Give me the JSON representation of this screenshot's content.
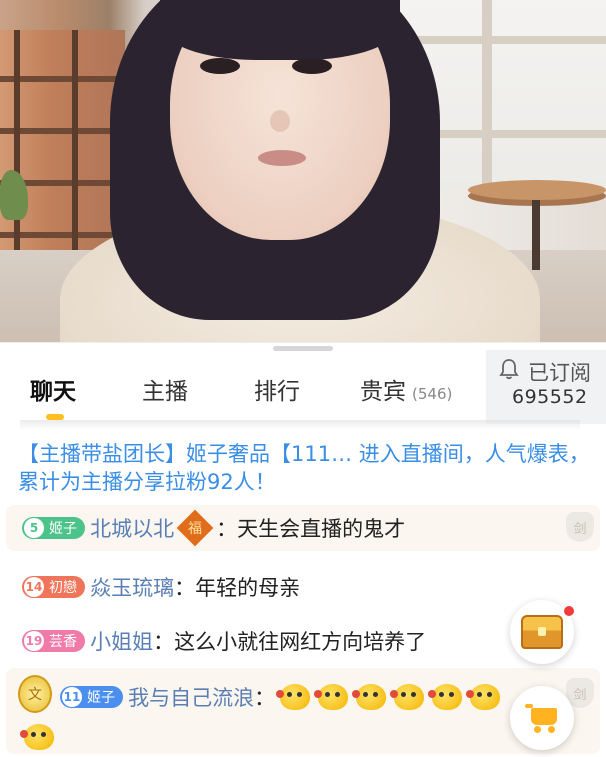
{
  "tabs": {
    "chat": "聊天",
    "host": "主播",
    "ranking": "排行",
    "guests": "贵宾",
    "guests_count": "(546)"
  },
  "subscribe": {
    "label": "已订阅",
    "count": "695552"
  },
  "system_message": "【主播带盐团长】姬子奢品【111… 进入直播间，人气爆表，累计为主播分享拉粉92人！",
  "messages": [
    {
      "badge_level": "5",
      "badge_name": "姬子",
      "badge_color": "#4cc38a",
      "nickname": "北城以北",
      "fu_glyph": "福",
      "text": "天生会直播的鬼才"
    },
    {
      "badge_level": "14",
      "badge_name": "初戀",
      "badge_color": "#f0745a",
      "nickname": "焱玉琉璃",
      "text": "年轻的母亲"
    },
    {
      "badge_level": "19",
      "badge_name": "芸香",
      "badge_color": "#f07aa8",
      "nickname": "小姐姐",
      "text": "这么小就往网红方向培养了"
    },
    {
      "badge_level": "11",
      "badge_name": "姬子",
      "badge_color": "#4a8ff0",
      "nickname": "我与自己流浪",
      "emoji_name": "tiger-emoji"
    }
  ],
  "shield_glyph": "剑",
  "avatar_emblem_glyph": "文",
  "icons": {
    "bell": "bell-icon",
    "treasure": "treasure-chest-icon",
    "cart": "shopping-cart-icon"
  },
  "colors": {
    "accent": "#ffbf1f",
    "system_text": "#3a8ee6",
    "nickname": "#5a7fb5"
  }
}
